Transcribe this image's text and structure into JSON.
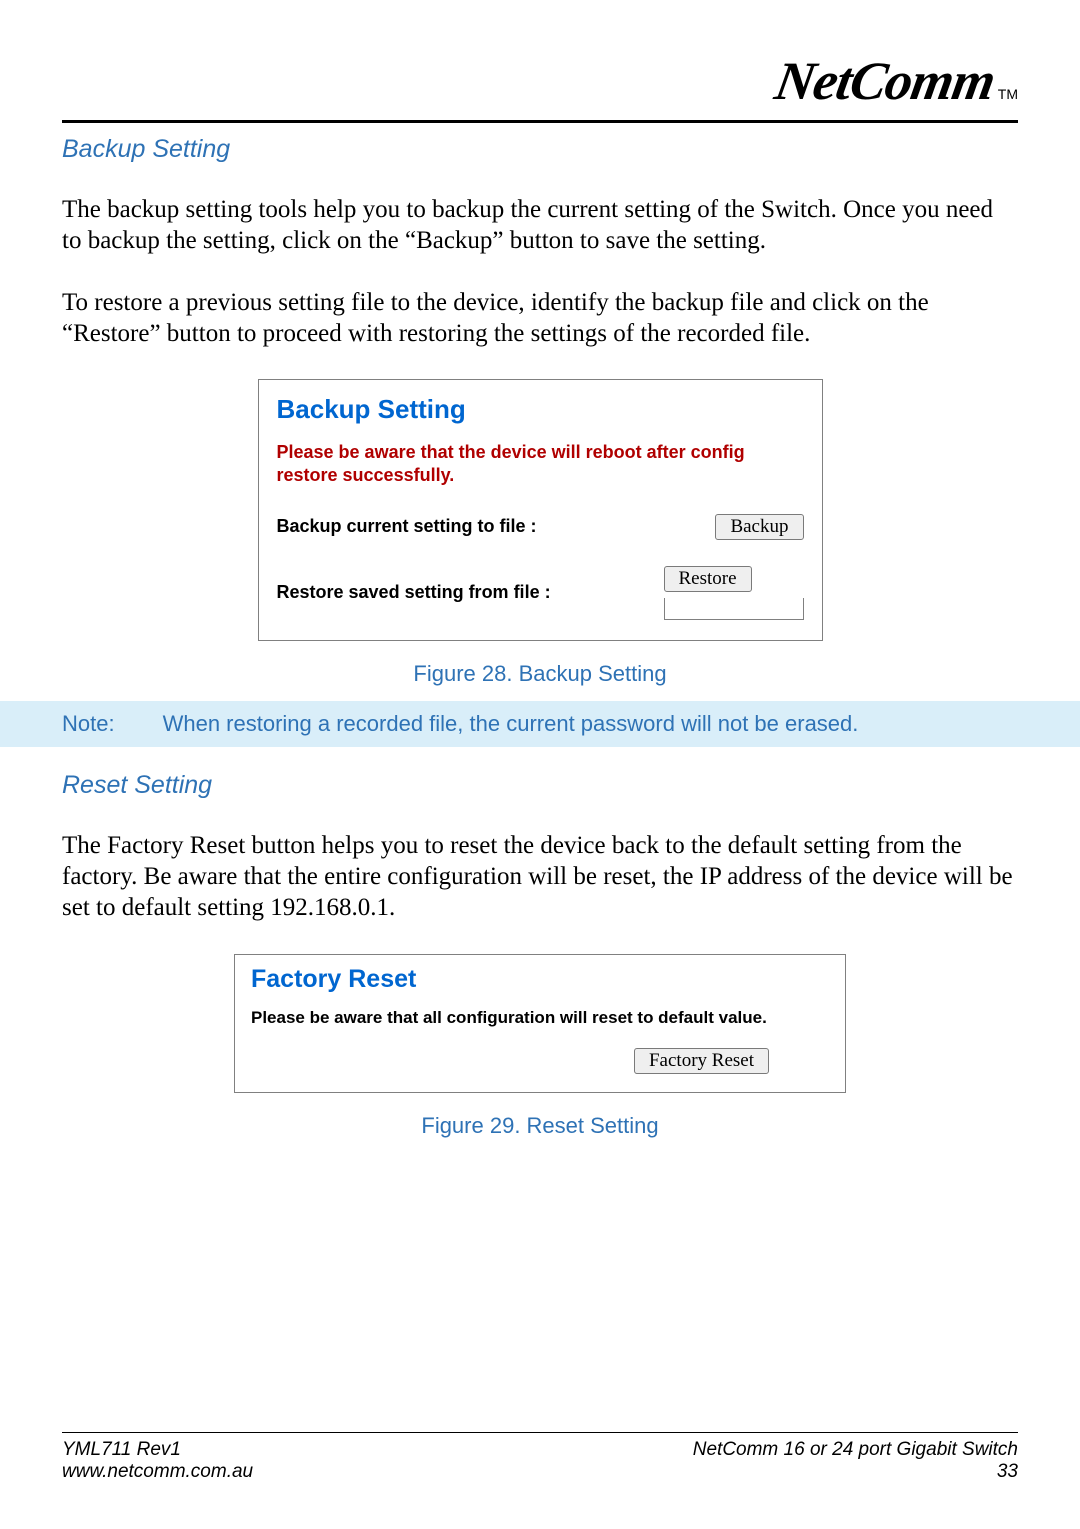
{
  "logo_text": "NetComm",
  "logo_tm": "TM",
  "backup": {
    "heading": "Backup Setting",
    "para1": "The backup setting tools help you to backup the current setting of the Switch.  Once you need to backup the setting, click on the “Backup” button to save the setting.",
    "para2": "To restore a previous setting file to the device, identify the backup file and click on the “Restore” button to proceed with restoring the settings of the recorded file.",
    "panel": {
      "title": "Backup Setting",
      "warning": "Please be aware that the device will reboot after config restore successfully.",
      "backup_label": "Backup current setting to file :",
      "backup_btn": "Backup",
      "restore_label": "Restore saved setting from file :",
      "restore_btn": "Restore"
    },
    "caption": "Figure 28. Backup Setting"
  },
  "note": {
    "label": "Note:",
    "text": "When restoring a recorded file, the current password will not be erased."
  },
  "reset": {
    "heading": "Reset Setting",
    "para": "The Factory Reset button helps you to reset the device back to the default setting from the factory.  Be aware that the entire configuration will be reset, the IP address of the device will be set to default setting 192.168.0.1.",
    "panel": {
      "title": "Factory Reset",
      "warning": "Please be aware that all configuration will reset to default value.",
      "btn": "Factory Reset"
    },
    "caption": "Figure 29. Reset Setting"
  },
  "footer": {
    "doc_id": "YML711 Rev1",
    "url": "www.netcomm.com.au",
    "product": "NetComm 16 or 24 port Gigabit Switch",
    "page": "33"
  }
}
